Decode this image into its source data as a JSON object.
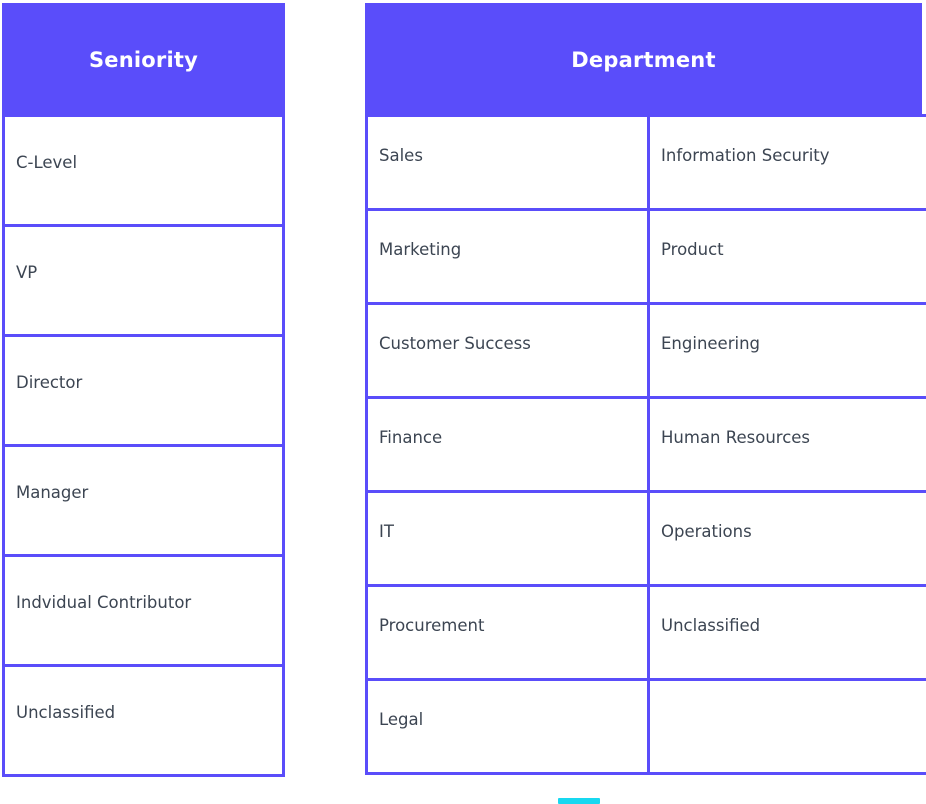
{
  "page": {
    "background_color": "#ffffff",
    "accent_color": "#5a4dfa",
    "header_text_color": "#ffffff",
    "cell_text_color": "#3c4552",
    "bottom_accent_color": "#18d8f0"
  },
  "tables": [
    {
      "id": "seniority",
      "title": "Seniority",
      "columns": 1,
      "rows": [
        [
          "C-Level"
        ],
        [
          "VP"
        ],
        [
          "Director"
        ],
        [
          "Manager"
        ],
        [
          "Indvidual Contributor"
        ],
        [
          "Unclassified"
        ]
      ]
    },
    {
      "id": "department",
      "title": "Department",
      "columns": 2,
      "rows": [
        [
          "Sales",
          "Information Security"
        ],
        [
          "Marketing",
          "Product"
        ],
        [
          "Customer Success",
          "Engineering"
        ],
        [
          "Finance",
          "Human Resources"
        ],
        [
          "IT",
          "Operations"
        ],
        [
          "Procurement",
          "Unclassified"
        ],
        [
          "Legal",
          ""
        ]
      ]
    }
  ],
  "bottom_accent": {
    "label": "scroll-indicator"
  }
}
